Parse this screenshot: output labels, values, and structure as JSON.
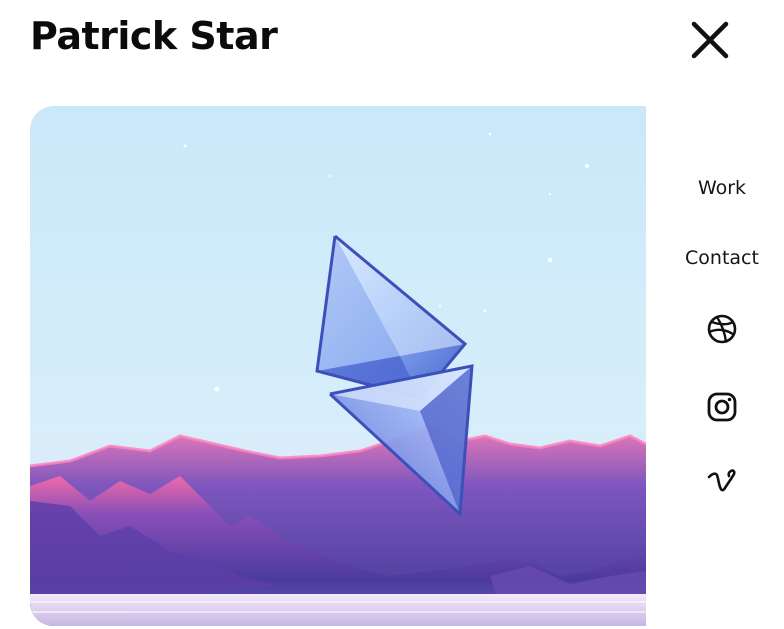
{
  "header": {
    "title": "Patrick Star"
  },
  "nav": {
    "work_label": "Work",
    "contact_label": "Contact"
  },
  "social": [
    "dribbble-icon",
    "instagram-icon",
    "vimeo-icon"
  ],
  "hero": {
    "image": "3d-crystal-octahedron-over-pink-purple-mountains"
  },
  "colors": {
    "text": "#111111",
    "sky_top": "#cfe9f8",
    "mountain": "#5a3fa3",
    "mountain_glow": "#e0559b"
  }
}
